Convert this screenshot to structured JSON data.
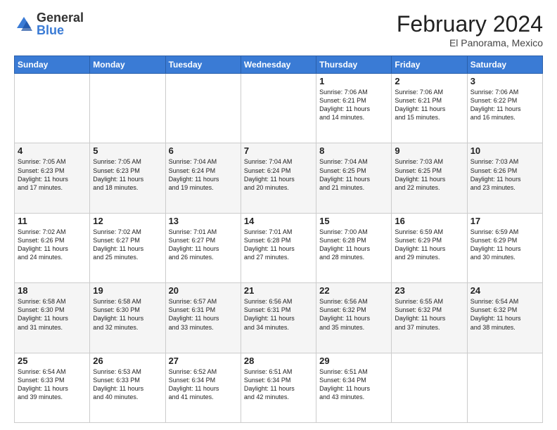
{
  "logo": {
    "general": "General",
    "blue": "Blue"
  },
  "title": {
    "month": "February 2024",
    "location": "El Panorama, Mexico"
  },
  "headers": [
    "Sunday",
    "Monday",
    "Tuesday",
    "Wednesday",
    "Thursday",
    "Friday",
    "Saturday"
  ],
  "weeks": [
    [
      {
        "day": "",
        "info": ""
      },
      {
        "day": "",
        "info": ""
      },
      {
        "day": "",
        "info": ""
      },
      {
        "day": "",
        "info": ""
      },
      {
        "day": "1",
        "info": "Sunrise: 7:06 AM\nSunset: 6:21 PM\nDaylight: 11 hours\nand 14 minutes."
      },
      {
        "day": "2",
        "info": "Sunrise: 7:06 AM\nSunset: 6:21 PM\nDaylight: 11 hours\nand 15 minutes."
      },
      {
        "day": "3",
        "info": "Sunrise: 7:06 AM\nSunset: 6:22 PM\nDaylight: 11 hours\nand 16 minutes."
      }
    ],
    [
      {
        "day": "4",
        "info": "Sunrise: 7:05 AM\nSunset: 6:23 PM\nDaylight: 11 hours\nand 17 minutes."
      },
      {
        "day": "5",
        "info": "Sunrise: 7:05 AM\nSunset: 6:23 PM\nDaylight: 11 hours\nand 18 minutes."
      },
      {
        "day": "6",
        "info": "Sunrise: 7:04 AM\nSunset: 6:24 PM\nDaylight: 11 hours\nand 19 minutes."
      },
      {
        "day": "7",
        "info": "Sunrise: 7:04 AM\nSunset: 6:24 PM\nDaylight: 11 hours\nand 20 minutes."
      },
      {
        "day": "8",
        "info": "Sunrise: 7:04 AM\nSunset: 6:25 PM\nDaylight: 11 hours\nand 21 minutes."
      },
      {
        "day": "9",
        "info": "Sunrise: 7:03 AM\nSunset: 6:25 PM\nDaylight: 11 hours\nand 22 minutes."
      },
      {
        "day": "10",
        "info": "Sunrise: 7:03 AM\nSunset: 6:26 PM\nDaylight: 11 hours\nand 23 minutes."
      }
    ],
    [
      {
        "day": "11",
        "info": "Sunrise: 7:02 AM\nSunset: 6:26 PM\nDaylight: 11 hours\nand 24 minutes."
      },
      {
        "day": "12",
        "info": "Sunrise: 7:02 AM\nSunset: 6:27 PM\nDaylight: 11 hours\nand 25 minutes."
      },
      {
        "day": "13",
        "info": "Sunrise: 7:01 AM\nSunset: 6:27 PM\nDaylight: 11 hours\nand 26 minutes."
      },
      {
        "day": "14",
        "info": "Sunrise: 7:01 AM\nSunset: 6:28 PM\nDaylight: 11 hours\nand 27 minutes."
      },
      {
        "day": "15",
        "info": "Sunrise: 7:00 AM\nSunset: 6:28 PM\nDaylight: 11 hours\nand 28 minutes."
      },
      {
        "day": "16",
        "info": "Sunrise: 6:59 AM\nSunset: 6:29 PM\nDaylight: 11 hours\nand 29 minutes."
      },
      {
        "day": "17",
        "info": "Sunrise: 6:59 AM\nSunset: 6:29 PM\nDaylight: 11 hours\nand 30 minutes."
      }
    ],
    [
      {
        "day": "18",
        "info": "Sunrise: 6:58 AM\nSunset: 6:30 PM\nDaylight: 11 hours\nand 31 minutes."
      },
      {
        "day": "19",
        "info": "Sunrise: 6:58 AM\nSunset: 6:30 PM\nDaylight: 11 hours\nand 32 minutes."
      },
      {
        "day": "20",
        "info": "Sunrise: 6:57 AM\nSunset: 6:31 PM\nDaylight: 11 hours\nand 33 minutes."
      },
      {
        "day": "21",
        "info": "Sunrise: 6:56 AM\nSunset: 6:31 PM\nDaylight: 11 hours\nand 34 minutes."
      },
      {
        "day": "22",
        "info": "Sunrise: 6:56 AM\nSunset: 6:32 PM\nDaylight: 11 hours\nand 35 minutes."
      },
      {
        "day": "23",
        "info": "Sunrise: 6:55 AM\nSunset: 6:32 PM\nDaylight: 11 hours\nand 37 minutes."
      },
      {
        "day": "24",
        "info": "Sunrise: 6:54 AM\nSunset: 6:32 PM\nDaylight: 11 hours\nand 38 minutes."
      }
    ],
    [
      {
        "day": "25",
        "info": "Sunrise: 6:54 AM\nSunset: 6:33 PM\nDaylight: 11 hours\nand 39 minutes."
      },
      {
        "day": "26",
        "info": "Sunrise: 6:53 AM\nSunset: 6:33 PM\nDaylight: 11 hours\nand 40 minutes."
      },
      {
        "day": "27",
        "info": "Sunrise: 6:52 AM\nSunset: 6:34 PM\nDaylight: 11 hours\nand 41 minutes."
      },
      {
        "day": "28",
        "info": "Sunrise: 6:51 AM\nSunset: 6:34 PM\nDaylight: 11 hours\nand 42 minutes."
      },
      {
        "day": "29",
        "info": "Sunrise: 6:51 AM\nSunset: 6:34 PM\nDaylight: 11 hours\nand 43 minutes."
      },
      {
        "day": "",
        "info": ""
      },
      {
        "day": "",
        "info": ""
      }
    ]
  ]
}
